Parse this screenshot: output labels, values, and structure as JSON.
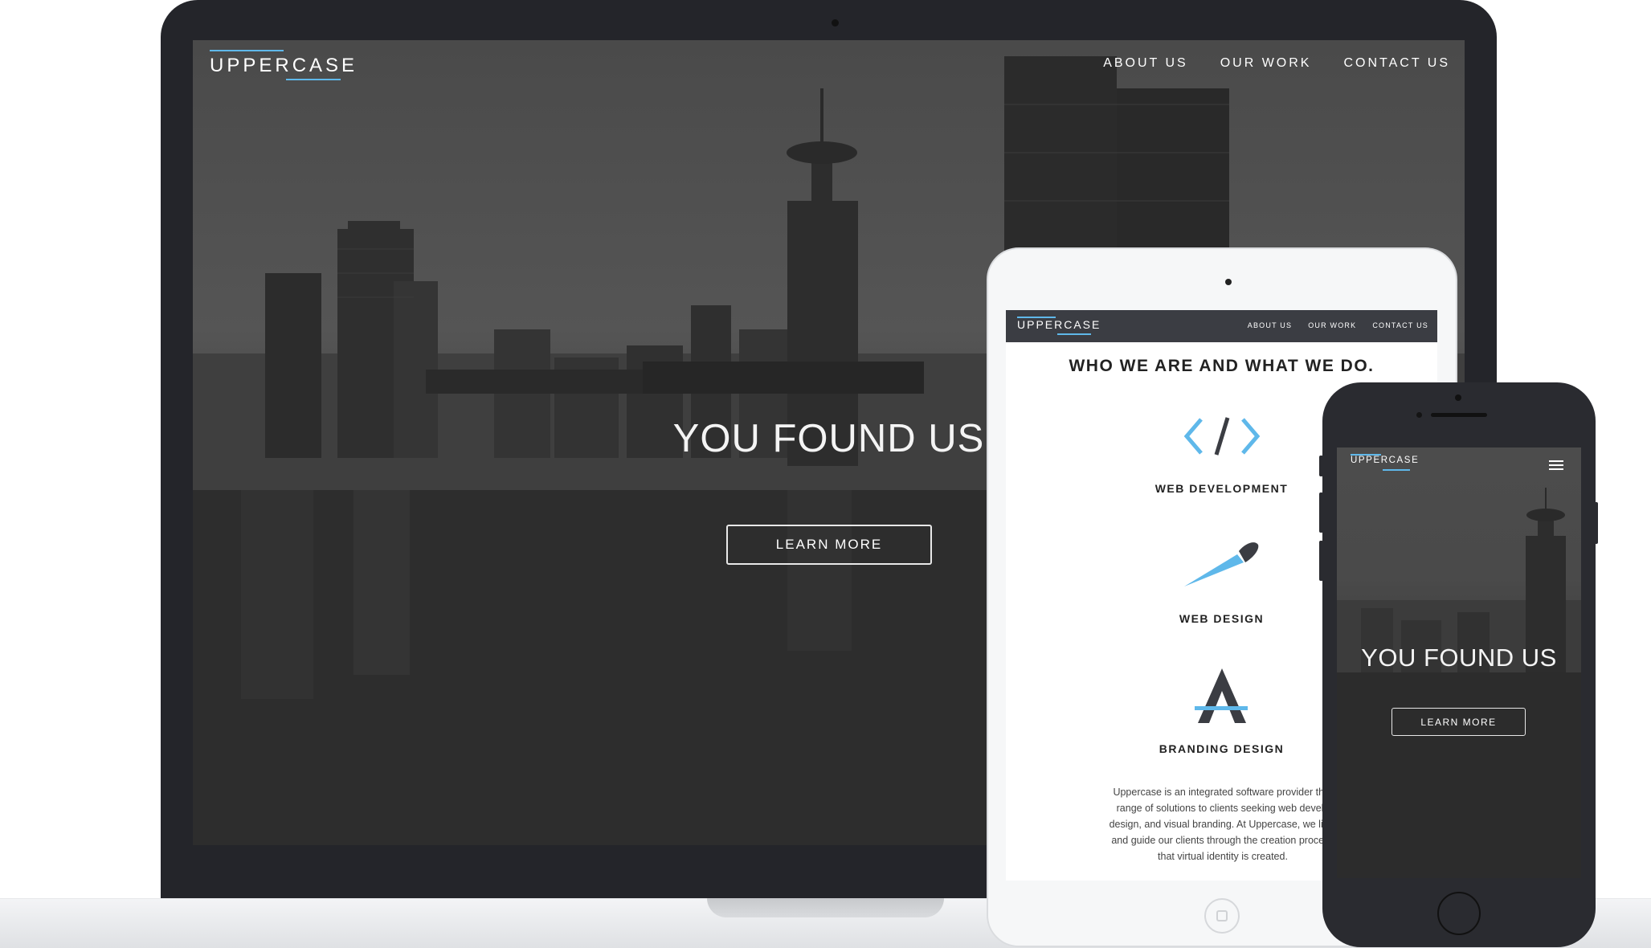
{
  "brand": {
    "logo_text": "UPPERCASE",
    "accent_color": "#5fb8ea"
  },
  "laptop": {
    "nav": [
      "ABOUT US",
      "OUR WORK",
      "CONTACT US"
    ],
    "hero_title": "YOU FOUND US",
    "cta_label": "LEARN MORE"
  },
  "tablet": {
    "nav": [
      "ABOUT US",
      "OUR WORK",
      "CONTACT US"
    ],
    "heading": "WHO WE ARE AND WHAT WE DO.",
    "services": [
      {
        "label": "WEB DEVELOPMENT",
        "icon": "code-icon"
      },
      {
        "label": "WEB DESIGN",
        "icon": "paintbrush-icon"
      },
      {
        "label": "BRANDING DESIGN",
        "icon": "letter-a-icon"
      }
    ],
    "paragraph_lines": [
      "Uppercase is an integrated software provider that",
      "range of solutions to clients seeking web develo",
      "design, and visual branding. At Uppercase, we liste",
      "and guide our clients through the creation process",
      "that virtual identity is created."
    ]
  },
  "phone": {
    "hero_title": "YOU FOUND US",
    "cta_label": "LEARN MORE",
    "menu_icon": "hamburger-menu-icon"
  }
}
